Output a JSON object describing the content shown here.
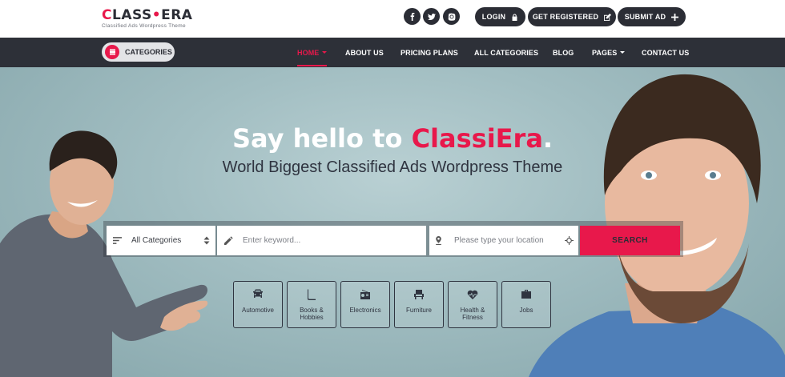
{
  "brand": {
    "logo_text_1": "C",
    "logo_text_2": "LASS",
    "logo_text_3": "ERA",
    "tagline": "Classified Ads Wordpress Theme"
  },
  "header": {
    "social": [
      "facebook-icon",
      "twitter-icon",
      "instagram-icon"
    ],
    "login_label": "LOGIN",
    "register_label": "GET REGISTERED",
    "submit_label": "SUBMIT AD"
  },
  "nav": {
    "categories_label": "CATEGORIES",
    "items": [
      {
        "label": "HOME",
        "active": true,
        "dropdown": true
      },
      {
        "label": "ABOUT US"
      },
      {
        "label": "PRICING PLANS"
      },
      {
        "label": "ALL CATEGORIES"
      },
      {
        "label": "BLOG"
      },
      {
        "label": "PAGES",
        "dropdown": true
      },
      {
        "label": "CONTACT US"
      }
    ]
  },
  "hero": {
    "title_prefix": "Say hello to ",
    "title_accent": "ClassiEra",
    "title_suffix": ".",
    "subtitle": "World Biggest Classified Ads Wordpress Theme"
  },
  "search": {
    "category_value": "All Categories",
    "keyword_placeholder": "Enter keyword...",
    "location_placeholder": "Please type your location",
    "button_label": "SEARCH"
  },
  "categories": [
    {
      "label": "Automotive",
      "icon": "car-icon"
    },
    {
      "label": "Books & Hobbies",
      "icon": "book-icon"
    },
    {
      "label": "Electronics",
      "icon": "radio-icon"
    },
    {
      "label": "Furniture",
      "icon": "chair-icon"
    },
    {
      "label": "Health & Fitness",
      "icon": "heartbeat-icon"
    },
    {
      "label": "Jobs",
      "icon": "briefcase-icon"
    }
  ],
  "colors": {
    "accent": "#e8184b",
    "dark": "#2d3038"
  }
}
